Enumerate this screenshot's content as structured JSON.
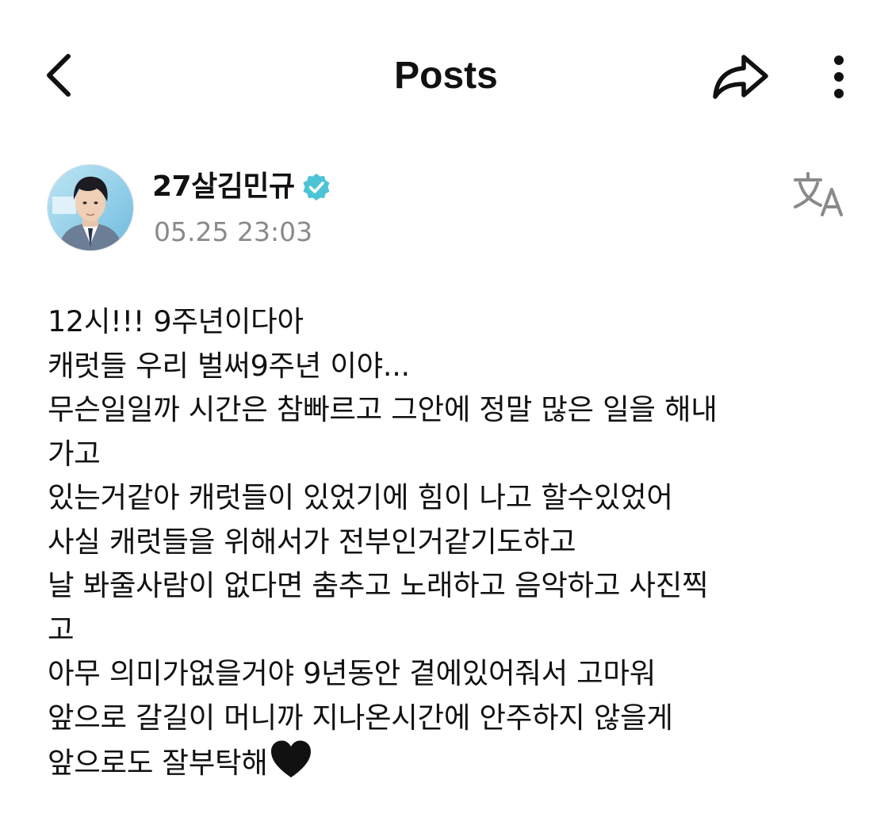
{
  "header": {
    "title": "Posts",
    "back_icon": "chevron-left-icon",
    "share_icon": "share-arrow-icon",
    "more_icon": "vertical-dots-icon"
  },
  "post": {
    "author": "27살김민규",
    "verified_icon": "verified-badge-icon",
    "verified_color": "#4cc4d6",
    "timestamp": "05.25 23:03",
    "translate_icon": "translate-icon",
    "lines": [
      "12시!!! 9주년이다아",
      "캐럿들 우리 벌써9주년 이야...",
      "무슨일일까 시간은 참빠르고 그안에 정말 많은 일을 해내",
      "가고",
      "있는거같아 캐럿들이 있었기에 힘이 나고 할수있었어",
      "사실 캐럿들을 위해서가 전부인거같기도하고",
      "날 봐줄사람이 없다면 춤추고 노래하고 음악하고 사진찍",
      "고",
      "아무 의미가없을거야 9년동안 곁에있어줘서 고마워",
      "앞으로 갈길이 머니까 지나온시간에 안주하지 않을게",
      "앞으로도 잘부탁해"
    ],
    "end_emoji": "black-heart-icon"
  }
}
